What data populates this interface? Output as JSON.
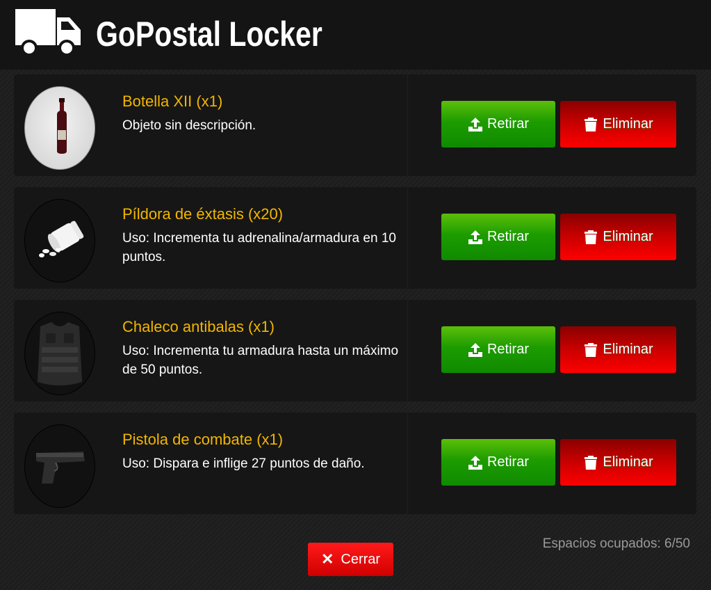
{
  "header": {
    "title": "GoPostal Locker",
    "icon": "truck-icon"
  },
  "items": [
    {
      "name": "Botella XII (x1)",
      "description": "Objeto sin descripción.",
      "image": "wine-bottle"
    },
    {
      "name": "Píldora de éxtasis (x20)",
      "description": "Uso: Incrementa tu adrenalina/armadura en 10 puntos.",
      "image": "pill-bottle"
    },
    {
      "name": "Chaleco antibalas (x1)",
      "description": "Uso: Incrementa tu armadura hasta un máximo de 50 puntos.",
      "image": "bulletproof-vest"
    },
    {
      "name": "Pistola de combate (x1)",
      "description": "Uso: Dispara e inflige 27 puntos de daño.",
      "image": "pistol"
    }
  ],
  "actions": {
    "withdraw_label": "Retirar",
    "delete_label": "Eliminar"
  },
  "footer": {
    "close_label": "Cerrar",
    "slots_text": "Espacios ocupados: 6/50"
  },
  "colors": {
    "title_gold": "#f2b600",
    "withdraw_green": "#1d9c00",
    "delete_red": "#e00000"
  }
}
